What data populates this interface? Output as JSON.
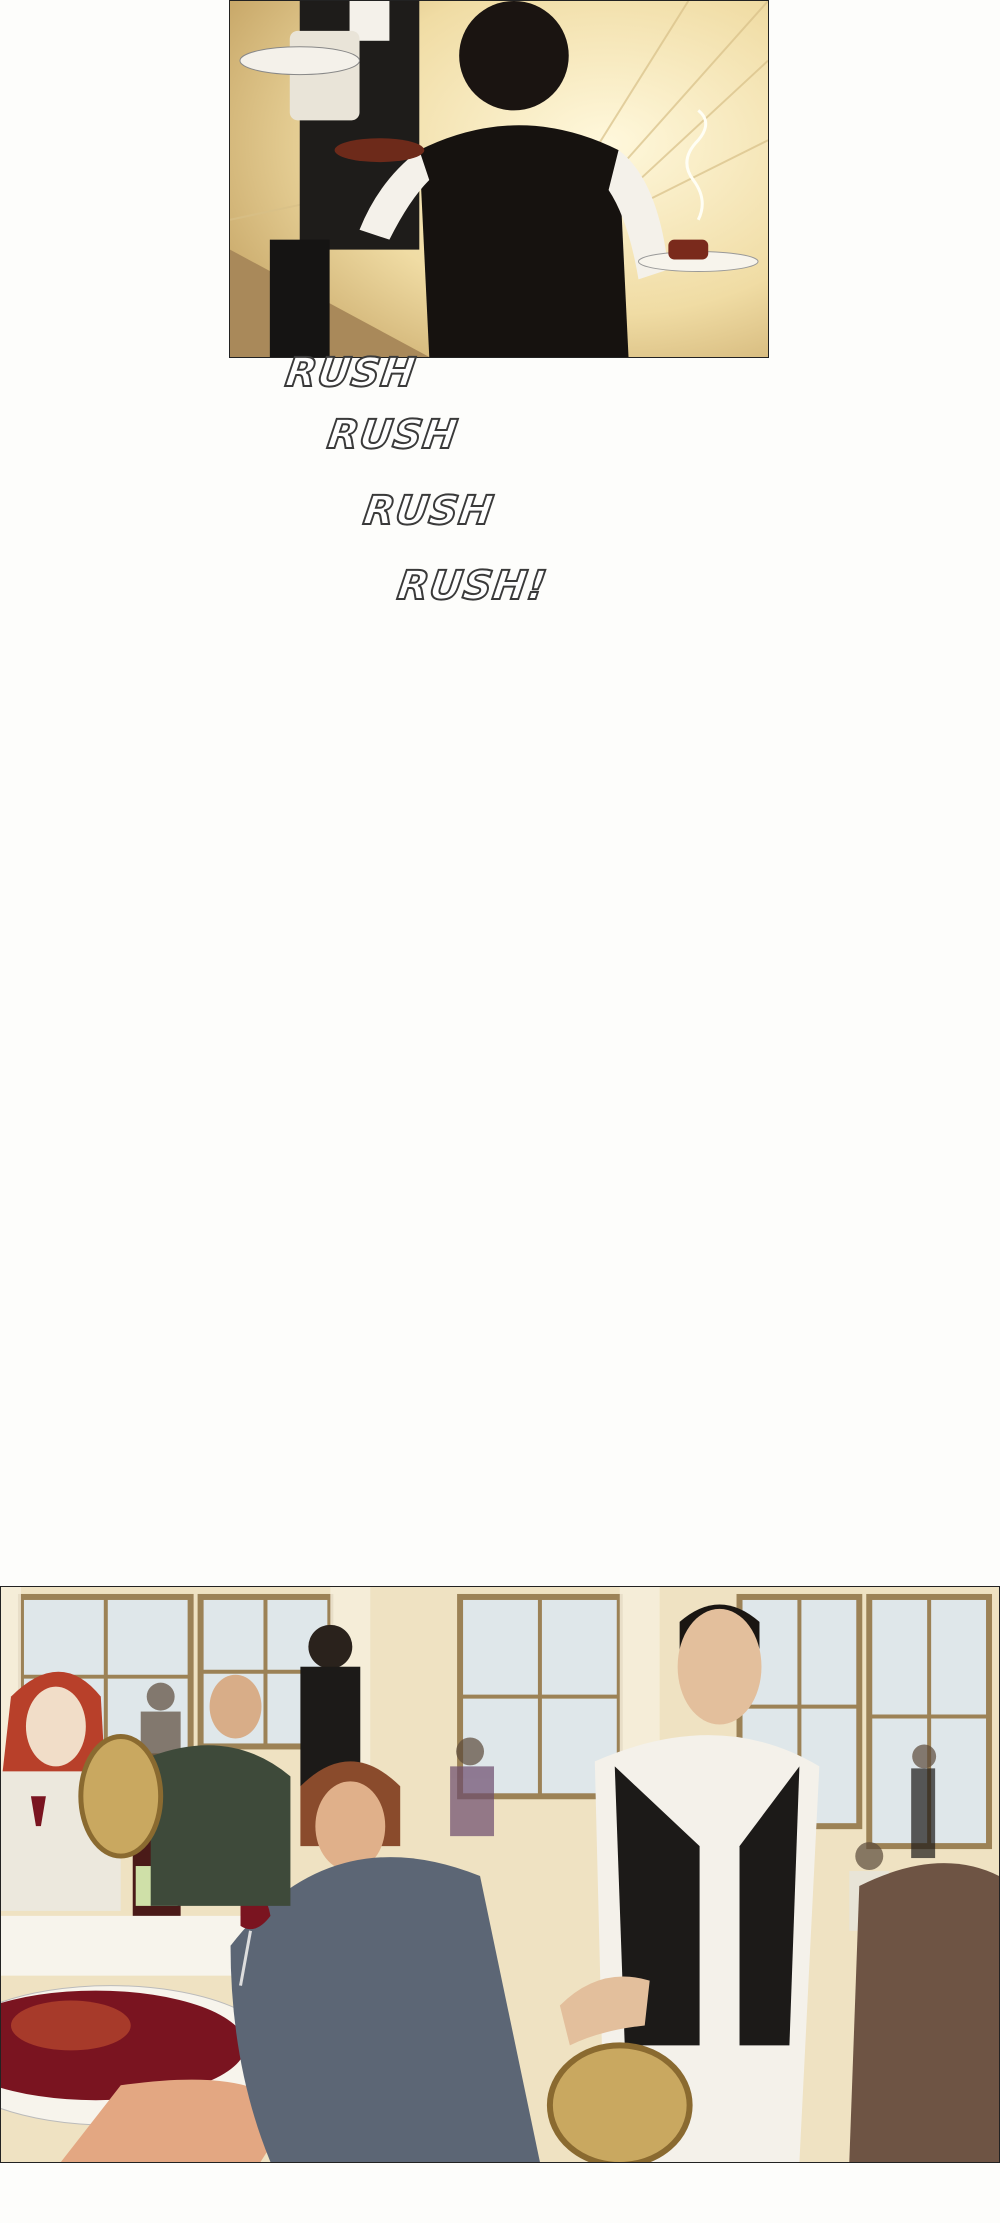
{
  "sound_effects": [
    "RUSH",
    "RUSH",
    "RUSH",
    "RUSH!"
  ],
  "palette": {
    "background": "#fdfdfb",
    "panel_border": "#222222",
    "warm_light": "#f3e2b0",
    "vest_black": "#1c1a18",
    "shirt_white": "#f4f1ea",
    "wine_red": "#7a1420",
    "window_light": "#e8eef0",
    "hair_auburn": "#b8402a"
  },
  "panels": [
    {
      "scene": "two-waiters-carrying-dishes"
    },
    {
      "scene": "restaurant-dining-room"
    }
  ]
}
